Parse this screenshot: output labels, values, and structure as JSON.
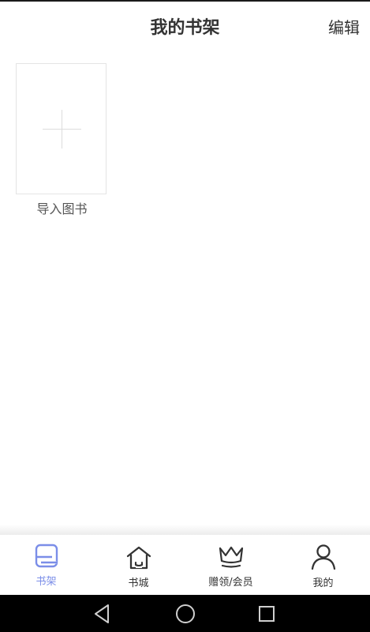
{
  "header": {
    "title": "我的书架",
    "edit_label": "编辑"
  },
  "shelf": {
    "import_label": "导入图书"
  },
  "tabbar": {
    "tabs": [
      {
        "label": "书架",
        "icon": "bookshelf-icon",
        "active": true
      },
      {
        "label": "书城",
        "icon": "bookstore-home-icon",
        "active": false
      },
      {
        "label": "赠领/会员",
        "icon": "crown-icon",
        "active": false
      },
      {
        "label": "我的",
        "icon": "user-icon",
        "active": false
      }
    ]
  },
  "colors": {
    "accent": "#7b8ee8",
    "text": "#333333",
    "nav_bar": "#000000"
  },
  "system_nav": {
    "icons": [
      "back-triangle-icon",
      "home-circle-icon",
      "recents-square-icon"
    ]
  }
}
